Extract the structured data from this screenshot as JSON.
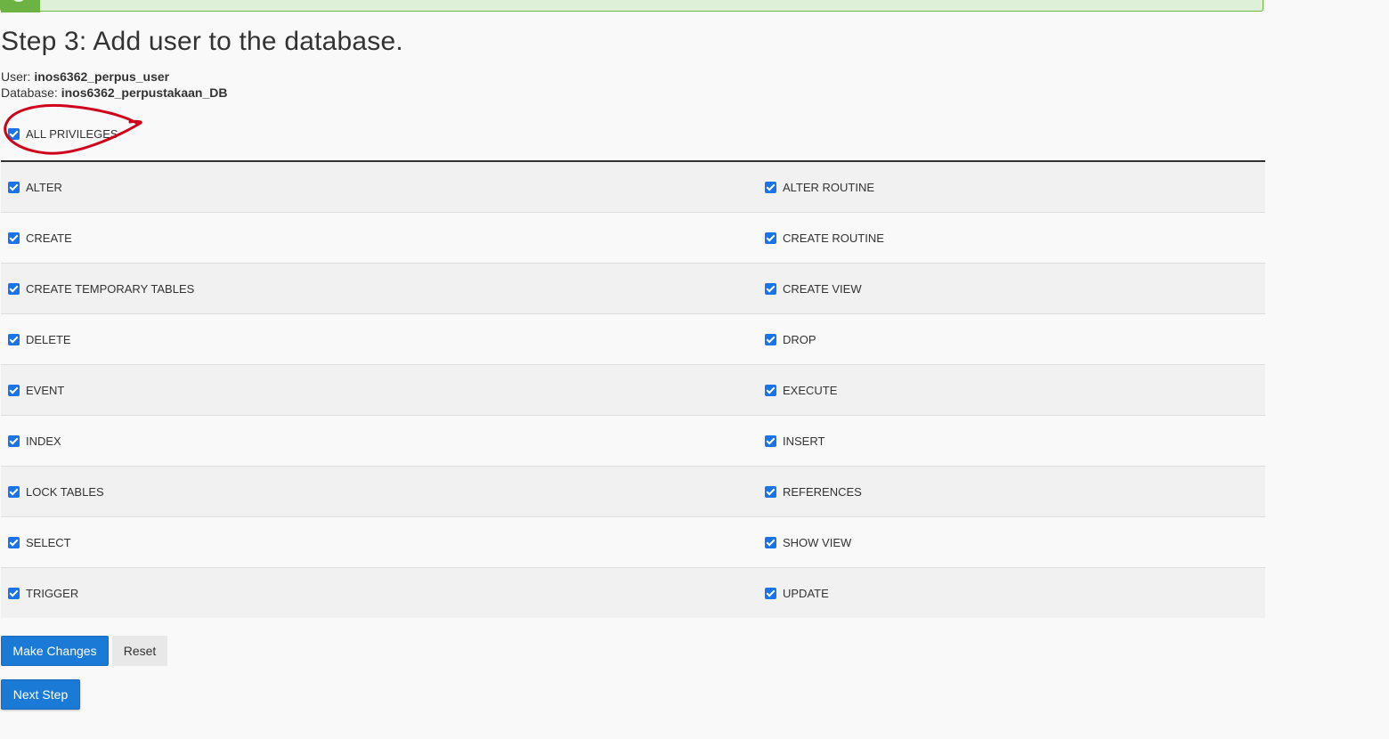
{
  "step": {
    "title": "Step 3: Add user to the database."
  },
  "info": {
    "user_label": "User:",
    "user_value": "inos6362_perpus_user",
    "database_label": "Database:",
    "database_value": "inos6362_perpustakaan_DB"
  },
  "all_privileges": {
    "label": "ALL PRIVILEGES",
    "checked": true
  },
  "privileges": {
    "rows": [
      {
        "left": "ALTER",
        "right": "ALTER ROUTINE"
      },
      {
        "left": "CREATE",
        "right": "CREATE ROUTINE"
      },
      {
        "left": "CREATE TEMPORARY TABLES",
        "right": "CREATE VIEW"
      },
      {
        "left": "DELETE",
        "right": "DROP"
      },
      {
        "left": "EVENT",
        "right": "EXECUTE"
      },
      {
        "left": "INDEX",
        "right": "INSERT"
      },
      {
        "left": "LOCK TABLES",
        "right": "REFERENCES"
      },
      {
        "left": "SELECT",
        "right": "SHOW VIEW"
      },
      {
        "left": "TRIGGER",
        "right": "UPDATE"
      }
    ]
  },
  "buttons": {
    "make_changes": "Make Changes",
    "reset": "Reset",
    "next_step": "Next Step"
  },
  "colors": {
    "primary": "#1a7ad6",
    "checkbox": "#1a73e8",
    "alert_border": "#6cb343",
    "annotation": "#d0021b"
  },
  "icons": {
    "checkbox": "checkbox-checked-icon",
    "alert": "success-icon",
    "annotation": "red-circle-annotation"
  }
}
